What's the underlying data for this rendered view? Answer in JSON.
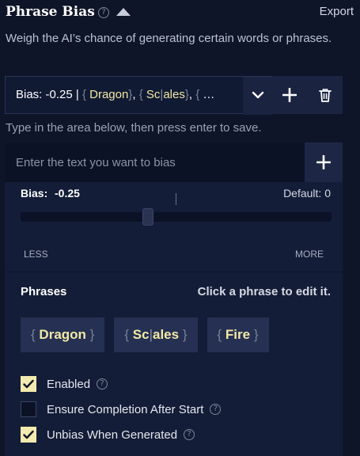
{
  "header": {
    "title": "Phrase Bias",
    "help_glyph": "?",
    "export_label": "Export"
  },
  "description": "Weigh the AI’s chance of generating certain words or phrases.",
  "selector": {
    "bias_prefix": "Bias: -0.25 |",
    "items": [
      "Dragon",
      "Scales"
    ],
    "ellipsis": "…"
  },
  "hint": "Type in the area below, then press enter to save.",
  "editor": {
    "placeholder": "Enter the text you want to bias",
    "bias_label": "Bias:",
    "bias_value": "-0.25",
    "default_label": "Default: 0",
    "slider_fraction": 0.41,
    "less_label": "LESS",
    "more_label": "MORE"
  },
  "phrases": {
    "title": "Phrases",
    "hint": "Click a phrase to edit it.",
    "chips": [
      "Dragon",
      "Scales",
      "Fire"
    ]
  },
  "options": [
    {
      "label": "Enabled",
      "checked": true
    },
    {
      "label": "Ensure Completion After Start",
      "checked": false
    },
    {
      "label": "Unbias When Generated",
      "checked": true
    }
  ],
  "colors": {
    "background": "#0e1529",
    "panel": "#141d37",
    "accent": "#f3eab0"
  }
}
